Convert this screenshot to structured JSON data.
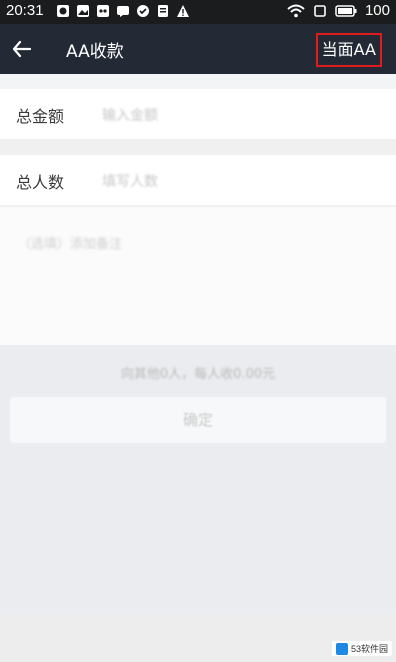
{
  "status_bar": {
    "time": "20:31",
    "notification_icons": [
      "alarm-icon",
      "photo-icon",
      "game-icon",
      "message-icon",
      "check-icon",
      "storage-icon",
      "warning-icon"
    ],
    "battery": "100"
  },
  "nav": {
    "title": "AA收款",
    "back_icon": "arrow-left-icon",
    "right_button": "当面AA",
    "highlight_color": "#e01b1b"
  },
  "form": {
    "amount_label": "总金额",
    "amount_placeholder": "输入金额",
    "people_label": "总人数",
    "people_placeholder": "填写人数",
    "note_placeholder": "（选填）添加备注"
  },
  "summary": "向其他0人，每人收0.00元",
  "confirm_button": "确定",
  "watermark": "53软件园"
}
